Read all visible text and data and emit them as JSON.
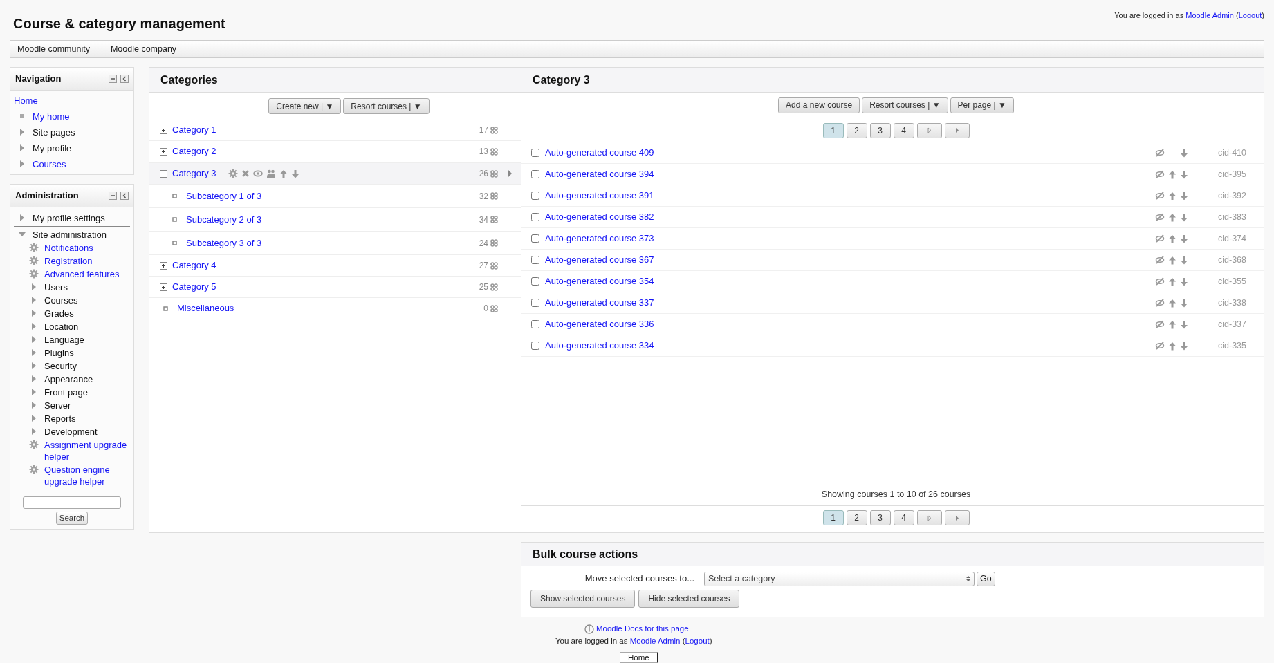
{
  "header": {
    "title": "Course & category management",
    "login": {
      "prefix": "You are logged in as",
      "user": "Moodle Admin",
      "open_paren": "(",
      "logout": "Logout",
      "close_paren": ")"
    }
  },
  "custom_menu": [
    "Moodle community",
    "Moodle company"
  ],
  "navigation": {
    "title": "Navigation",
    "items": [
      {
        "label": "Home",
        "kind": "home",
        "link": true
      },
      {
        "label": "My home",
        "kind": "leaf",
        "link": true
      },
      {
        "label": "Site pages",
        "kind": "branch",
        "link": false
      },
      {
        "label": "My profile",
        "kind": "branch",
        "link": false
      },
      {
        "label": "Courses",
        "kind": "branch",
        "link": true
      }
    ]
  },
  "administration": {
    "title": "Administration",
    "items": [
      {
        "label": "My profile settings",
        "kind": "branch",
        "link": false,
        "expanded": false
      },
      {
        "label": "Site administration",
        "kind": "branch",
        "link": false,
        "expanded": true,
        "children": [
          {
            "label": "Notifications",
            "kind": "setting",
            "link": true
          },
          {
            "label": "Registration",
            "kind": "setting",
            "link": true
          },
          {
            "label": "Advanced features",
            "kind": "setting",
            "link": true
          },
          {
            "label": "Users",
            "kind": "branch",
            "link": false,
            "expanded": false
          },
          {
            "label": "Courses",
            "kind": "branch",
            "link": false,
            "expanded": false
          },
          {
            "label": "Grades",
            "kind": "branch",
            "link": false,
            "expanded": false
          },
          {
            "label": "Location",
            "kind": "branch",
            "link": false,
            "expanded": false
          },
          {
            "label": "Language",
            "kind": "branch",
            "link": false,
            "expanded": false
          },
          {
            "label": "Plugins",
            "kind": "branch",
            "link": false,
            "expanded": false
          },
          {
            "label": "Security",
            "kind": "branch",
            "link": false,
            "expanded": false
          },
          {
            "label": "Appearance",
            "kind": "branch",
            "link": false,
            "expanded": false
          },
          {
            "label": "Front page",
            "kind": "branch",
            "link": false,
            "expanded": false
          },
          {
            "label": "Server",
            "kind": "branch",
            "link": false,
            "expanded": false
          },
          {
            "label": "Reports",
            "kind": "branch",
            "link": false,
            "expanded": false
          },
          {
            "label": "Development",
            "kind": "branch",
            "link": false,
            "expanded": false
          },
          {
            "label": "Assignment upgrade helper",
            "kind": "setting",
            "link": true
          },
          {
            "label": "Question engine upgrade helper",
            "kind": "setting",
            "link": true
          }
        ]
      }
    ],
    "search_button": "Search"
  },
  "categories": {
    "title": "Categories",
    "buttons": [
      "Create new | ▼",
      "Resort courses | ▼"
    ],
    "items": [
      {
        "name": "Category 1",
        "count": "17",
        "kind": "parent",
        "expanded": false,
        "selected": false
      },
      {
        "name": "Category 2",
        "count": "13",
        "kind": "parent",
        "expanded": false,
        "selected": false
      },
      {
        "name": "Category 3",
        "count": "26",
        "kind": "parent",
        "expanded": true,
        "selected": true,
        "children": [
          {
            "name": "Subcategory 1 of 3",
            "count": "32",
            "kind": "leaf",
            "selected": false
          },
          {
            "name": "Subcategory 2 of 3",
            "count": "34",
            "kind": "leaf",
            "selected": false
          },
          {
            "name": "Subcategory 3 of 3",
            "count": "24",
            "kind": "leaf",
            "selected": false
          }
        ]
      },
      {
        "name": "Category 4",
        "count": "27",
        "kind": "parent",
        "expanded": false,
        "selected": false
      },
      {
        "name": "Category 5",
        "count": "25",
        "kind": "parent",
        "expanded": false,
        "selected": false
      },
      {
        "name": "Miscellaneous",
        "count": "0",
        "kind": "leaf",
        "selected": false
      }
    ]
  },
  "courses": {
    "title": "Category 3",
    "buttons": [
      "Add a new course",
      "Resort courses | ▼",
      "Per page | ▼"
    ],
    "pages_top": [
      {
        "label": "1",
        "selected": true
      },
      {
        "label": "2",
        "selected": false
      },
      {
        "label": "3",
        "selected": false
      },
      {
        "label": "4",
        "selected": false
      }
    ],
    "pages_bottom": [
      {
        "label": "1",
        "selected": true
      },
      {
        "label": "2",
        "selected": false
      },
      {
        "label": "3",
        "selected": false
      },
      {
        "label": "4",
        "selected": false
      }
    ],
    "rows": [
      {
        "name": "Auto-generated course 409",
        "id": "cid-410",
        "checked": false,
        "can_move_up": false
      },
      {
        "name": "Auto-generated course 394",
        "id": "cid-395",
        "checked": false,
        "can_move_up": true
      },
      {
        "name": "Auto-generated course 391",
        "id": "cid-392",
        "checked": false,
        "can_move_up": true
      },
      {
        "name": "Auto-generated course 382",
        "id": "cid-383",
        "checked": false,
        "can_move_up": true
      },
      {
        "name": "Auto-generated course 373",
        "id": "cid-374",
        "checked": false,
        "can_move_up": true
      },
      {
        "name": "Auto-generated course 367",
        "id": "cid-368",
        "checked": false,
        "can_move_up": true
      },
      {
        "name": "Auto-generated course 354",
        "id": "cid-355",
        "checked": false,
        "can_move_up": true
      },
      {
        "name": "Auto-generated course 337",
        "id": "cid-338",
        "checked": false,
        "can_move_up": true
      },
      {
        "name": "Auto-generated course 336",
        "id": "cid-337",
        "checked": false,
        "can_move_up": true
      },
      {
        "name": "Auto-generated course 334",
        "id": "cid-335",
        "checked": false,
        "can_move_up": true
      }
    ],
    "summary": "Showing courses 1 to 10 of 26 courses"
  },
  "bulk": {
    "title": "Bulk course actions",
    "move_label": "Move selected courses to...",
    "select_value": "Select a category",
    "go": "Go",
    "buttons": [
      "Show selected courses",
      "Hide selected courses"
    ]
  },
  "footer": {
    "docs_link": "Moodle Docs for this page",
    "login": {
      "prefix": "You are logged in as",
      "user": "Moodle Admin",
      "open_paren": "(",
      "logout": "Logout",
      "close_paren": ")"
    },
    "home_button": "Home"
  }
}
